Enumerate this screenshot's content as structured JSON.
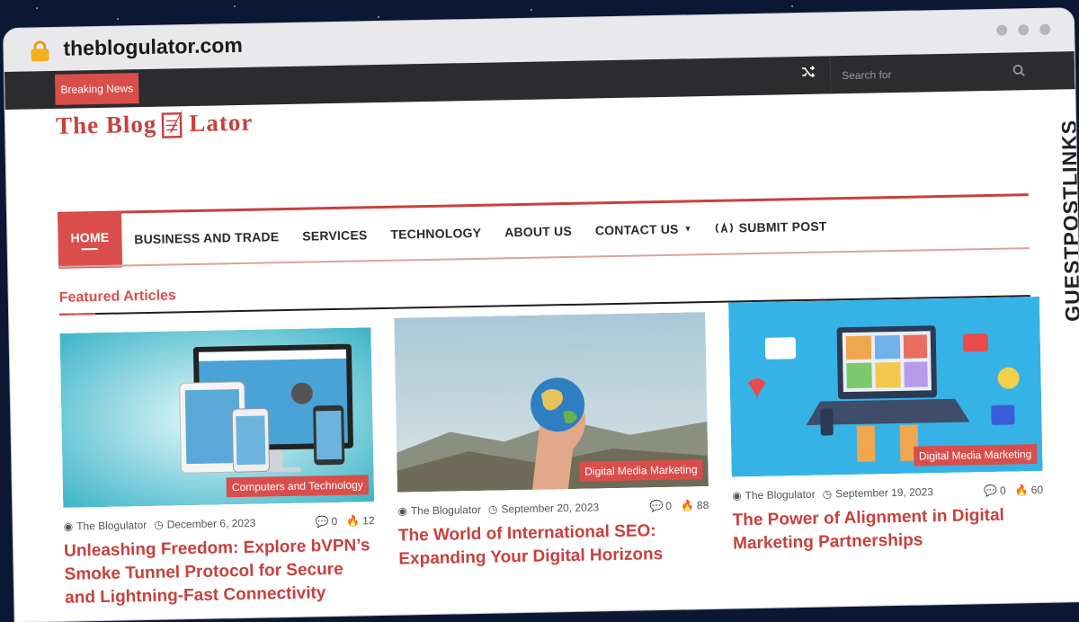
{
  "browser": {
    "url": "theblogulator.com"
  },
  "topbar": {
    "breaking_label": "Breaking News",
    "search_placeholder": "Search for"
  },
  "logo": {
    "part1": "The Blog",
    "part2": "Lator"
  },
  "nav": {
    "items": [
      {
        "label": "HOME"
      },
      {
        "label": "BUSINESS AND TRADE"
      },
      {
        "label": "SERVICES"
      },
      {
        "label": "TECHNOLOGY"
      },
      {
        "label": "ABOUT US"
      },
      {
        "label": "CONTACT US"
      },
      {
        "label": "SUBMIT POST"
      }
    ]
  },
  "featured": {
    "heading": "Featured Articles",
    "cards": [
      {
        "category": "Computers and Technology",
        "author": "The Blogulator",
        "date": "December 6, 2023",
        "comments": "0",
        "views": "12",
        "title": "Unleashing Freedom: Explore bVPN’s Smoke Tunnel Protocol for Secure and Lightning-Fast Connectivity"
      },
      {
        "category": "Digital Media Marketing",
        "author": "The Blogulator",
        "date": "September 20, 2023",
        "comments": "0",
        "views": "88",
        "title": "The World of International SEO: Expanding Your Digital Horizons"
      },
      {
        "category": "Digital Media Marketing",
        "author": "The Blogulator",
        "date": "September 19, 2023",
        "comments": "0",
        "views": "60",
        "title": "The Power of Alignment in Digital Marketing Partnerships"
      }
    ]
  },
  "badge": {
    "text": "GUESTPOSTLINKS"
  },
  "colors": {
    "accent": "#d94e4b",
    "topbar": "#2c2c2e",
    "background": "#0c1733"
  }
}
